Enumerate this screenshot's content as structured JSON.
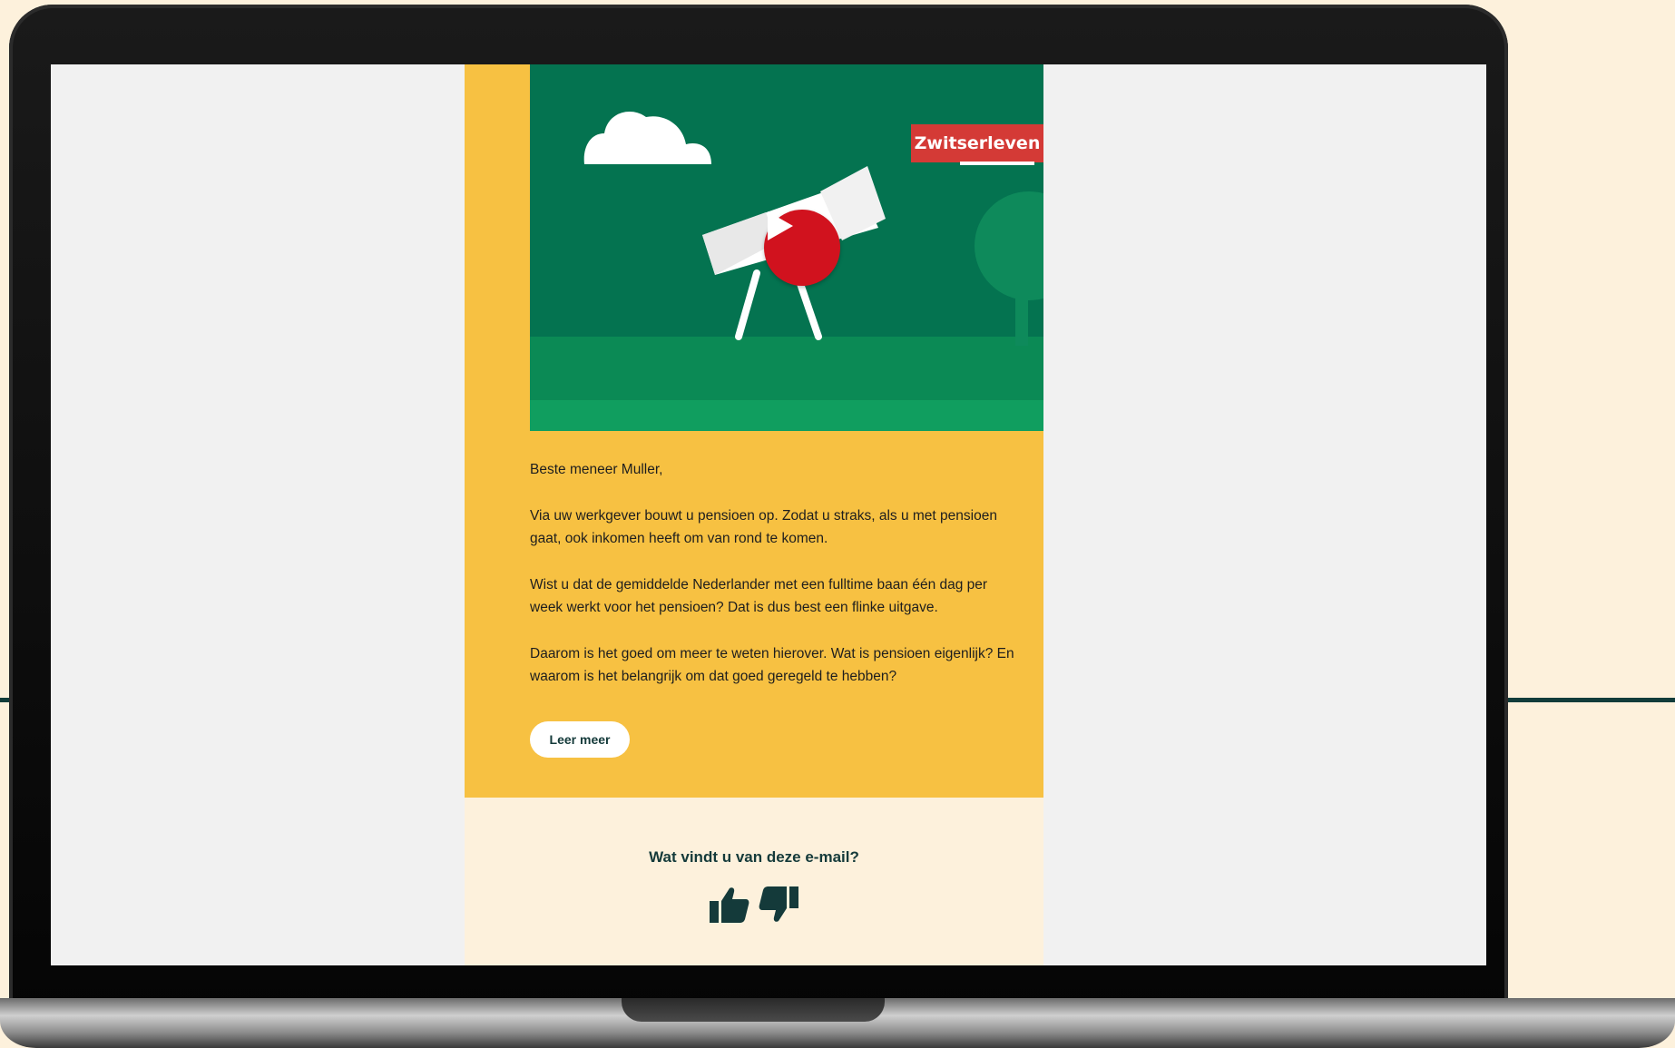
{
  "email": {
    "brand": "Zwitserleven",
    "greeting": "Beste meneer Muller,",
    "paragraphs": [
      "Via uw werkgever bouwt u pensioen op. Zodat u straks, als u met pensioen gaat, ook inkomen heeft om van rond te komen.",
      "Wist u dat de gemiddelde Nederlander met een fulltime baan één dag per week werkt voor het pensioen? Dat is dus best een flinke uitgave.",
      "Daarom is het goed om meer te weten hierover. Wat is pensioen eigenlijk? En waarom is het belangrijk om dat goed geregeld te hebben?"
    ],
    "cta_label": "Leer meer",
    "feedback_question": "Wat vindt u van deze e-mail?",
    "icons": {
      "play": "play-icon",
      "thumbs_up": "thumbs-up-icon",
      "thumbs_down": "thumbs-down-icon",
      "cloud": "cloud-icon",
      "telescope": "telescope-icon"
    }
  },
  "colors": {
    "page_background": "#fdf1dc",
    "card_yellow": "#f7c142",
    "hero_green": "#047350",
    "brand_red": "#d43a36",
    "play_red": "#d1121e",
    "dark_teal": "#143a3a"
  }
}
